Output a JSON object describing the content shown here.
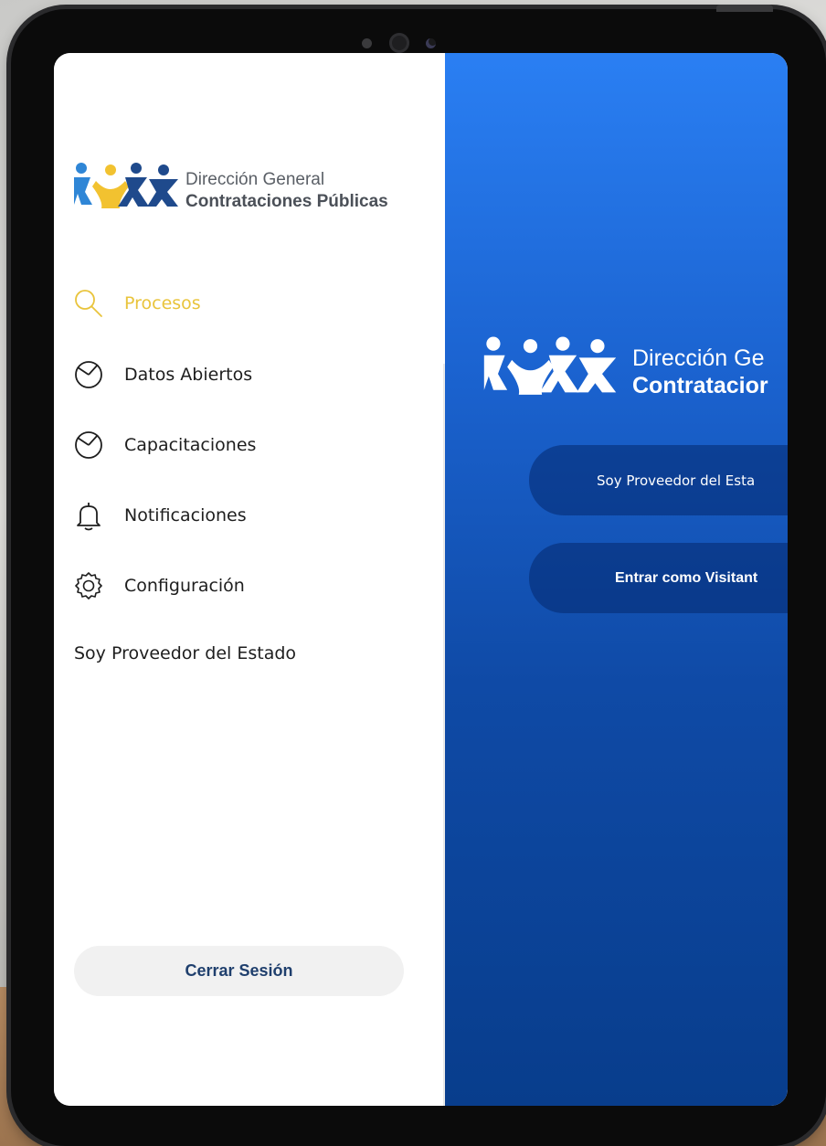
{
  "drawer": {
    "logo": {
      "line1": "Dirección General",
      "line2": "Contrataciones Públicas"
    },
    "menu": [
      {
        "label": "Procesos",
        "icon": "search-icon",
        "active": true
      },
      {
        "label": "Datos Abiertos",
        "icon": "pie-chart-icon",
        "active": false
      },
      {
        "label": "Capacitaciones",
        "icon": "pie-chart-icon",
        "active": false
      },
      {
        "label": "Notificaciones",
        "icon": "bell-icon",
        "active": false
      },
      {
        "label": "Configuración",
        "icon": "gear-icon",
        "active": false
      }
    ],
    "provider_link": "Soy Proveedor del Estado",
    "logout_label": "Cerrar Sesión"
  },
  "main": {
    "logo": {
      "line1": "Dirección Ge",
      "line2": "Contratacior"
    },
    "buttons": {
      "provider": "Soy Proveedor del Esta",
      "visitor": "Entrar como Visitant"
    }
  },
  "colors": {
    "accent_yellow": "#e9c43c",
    "logo_blue": "#1f4a8c",
    "logo_light_blue": "#2f86d6",
    "main_gradient_top": "#2a7ff3",
    "main_gradient_bottom": "#083d8c",
    "logout_text": "#1f3f6d"
  }
}
